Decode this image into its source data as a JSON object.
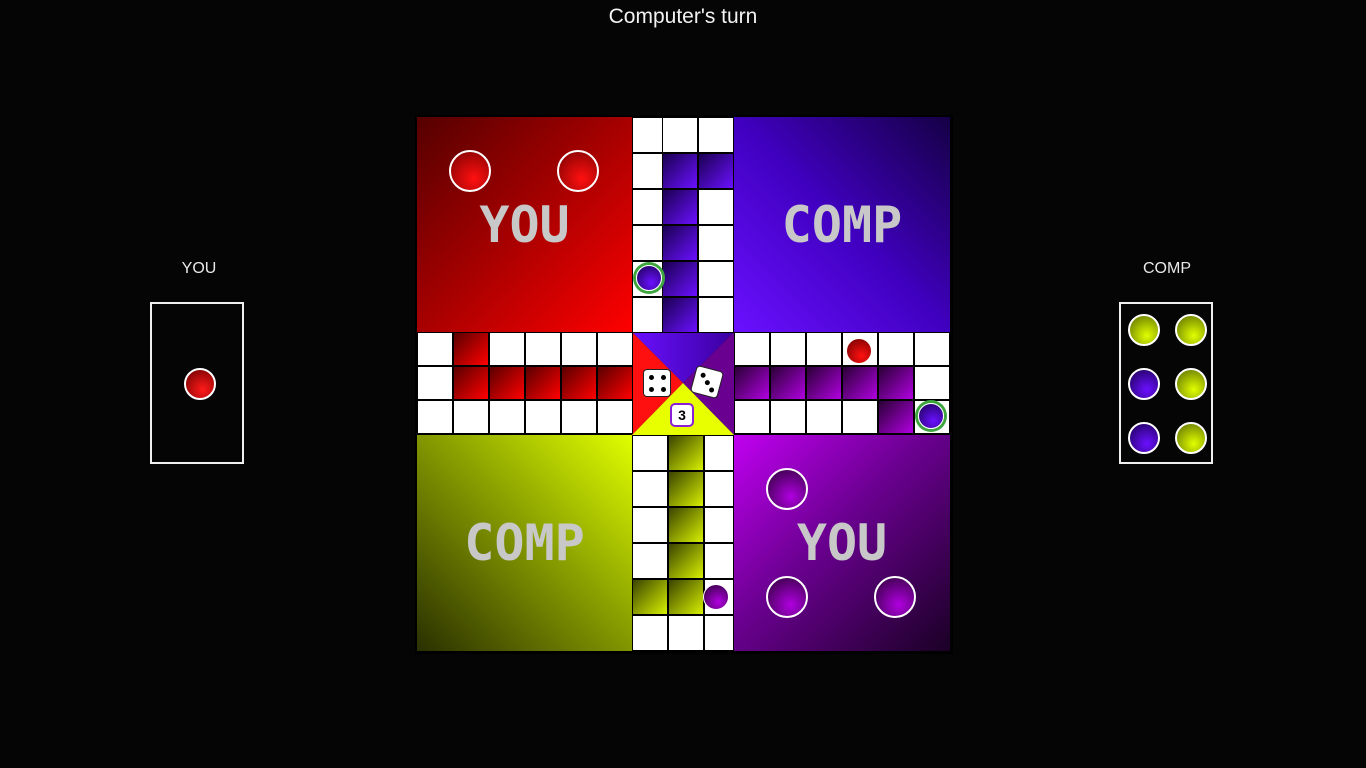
{
  "status": {
    "turn_text": "Computer's turn"
  },
  "left_panel": {
    "label": "YOU",
    "tokens": [
      "red"
    ]
  },
  "right_panel": {
    "label": "COMP",
    "tokens": [
      "yellow",
      "yellow",
      "blue",
      "yellow",
      "blue",
      "yellow"
    ]
  },
  "board": {
    "homes": {
      "red": "YOU",
      "blue": "COMP",
      "yellow": "COMP",
      "purple": "YOU"
    },
    "center": {
      "die_1": 4,
      "die_2": 3,
      "roll_total": "3"
    }
  },
  "colors": {
    "red": "#d40000",
    "blue": "#5a00e6",
    "yellow": "#c8e000",
    "purple": "#9a00d0",
    "highlight": "#3fa63f"
  }
}
